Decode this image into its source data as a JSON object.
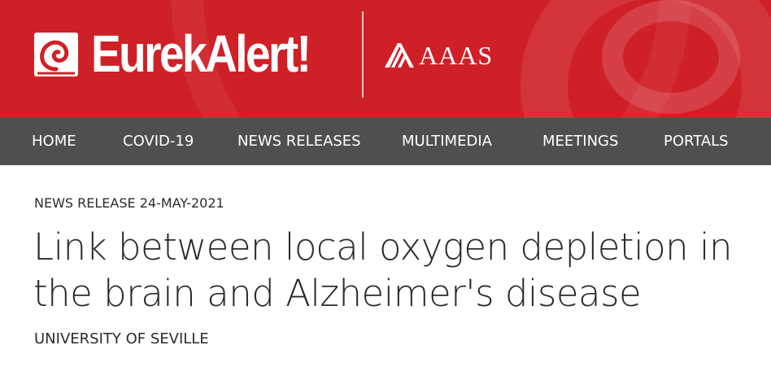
{
  "header": {
    "logo_text": "EurekAlert!",
    "partner_text": "AAAS",
    "colors": {
      "brand_red": "#cf2027",
      "nav_gray": "#4f4f4f"
    }
  },
  "nav": {
    "items": [
      {
        "label": "HOME"
      },
      {
        "label": "COVID-19"
      },
      {
        "label": "NEWS RELEASES"
      },
      {
        "label": "MULTIMEDIA"
      },
      {
        "label": "MEETINGS"
      },
      {
        "label": "PORTALS"
      }
    ]
  },
  "article": {
    "meta": "NEWS RELEASE 24-MAY-2021",
    "title": "Link between local oxygen depletion in the brain and Alzheimer's disease",
    "institution": "UNIVERSITY OF SEVILLE"
  }
}
